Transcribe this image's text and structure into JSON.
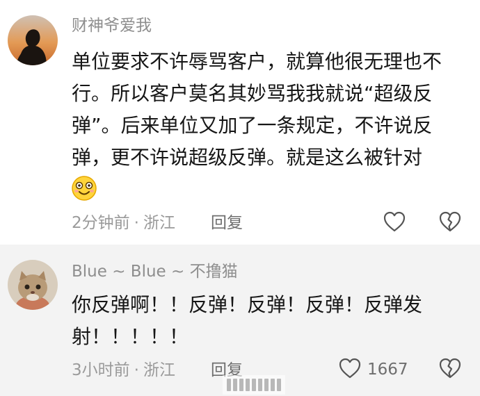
{
  "comments": [
    {
      "username": "财神爷爱我",
      "body_lines": [
        "单位要求不许辱骂客户，就算他很无理也不",
        "行。所以客户莫名其妙骂我我就说“超级反",
        "弹”。后来单位又加了一条规定，不许说反",
        "弹，更不许说超级反弹。就是这么被针对"
      ],
      "emoji": "grinning-face-emoji",
      "time": "2分钟前",
      "separator": "·",
      "location": "浙江",
      "reply_label": "回复",
      "like_icon": "heart-outline-icon",
      "dislike_icon": "broken-heart-outline-icon"
    },
    {
      "username": "Blue ~ Blue ~ 不撸猫",
      "body_lines": [
        "你反弹啊！！反弹！反弹！反弹！反弹发",
        "射！！！！！"
      ],
      "time": "3小时前",
      "separator": "·",
      "location": "浙江",
      "reply_label": "回复",
      "like_icon": "heart-outline-icon",
      "like_count": "1667",
      "dislike_icon": "broken-heart-outline-icon"
    }
  ],
  "colors": {
    "first_bg": "#ffffff",
    "second_bg": "#f3f3f3",
    "text": "#161616",
    "meta": "#9a9a9a"
  }
}
